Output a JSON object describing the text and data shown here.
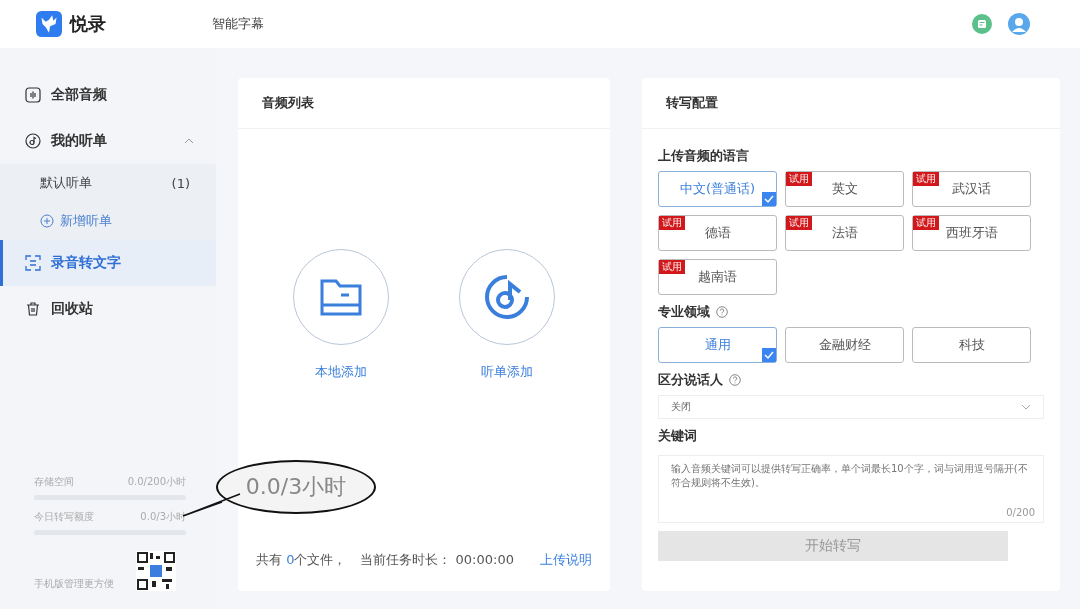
{
  "header": {
    "logo_text": "悦录",
    "nav_label": "智能字幕"
  },
  "sidebar": {
    "items": [
      {
        "kind": "audio",
        "label": "全部音频",
        "selected": false
      },
      {
        "kind": "group",
        "label": "我的听单",
        "expanded": true,
        "children": [
          {
            "label": "默认听单",
            "count": "(1)"
          }
        ],
        "add_label": "新增听单"
      },
      {
        "kind": "transcribe",
        "label": "录音转文字",
        "selected": true
      },
      {
        "kind": "trash",
        "label": "回收站",
        "selected": false
      }
    ],
    "usage": [
      {
        "label": "存储空间",
        "value": "0.0/200小时",
        "level": 0
      },
      {
        "label": "今日转写额度",
        "value": "0.0/3小时",
        "level": 0
      }
    ],
    "mobile_text": "手机版管理更方便"
  },
  "callout": {
    "text": "0.0/3小时"
  },
  "audio_list": {
    "title": "音频列表",
    "actions": [
      {
        "kind": "folder",
        "label": "本地添加"
      },
      {
        "kind": "disc",
        "label": "听单添加"
      }
    ],
    "footer": {
      "prefix": "共有",
      "count": "0",
      "suffix": "个文件，",
      "duration_label": "当前任务时长：",
      "duration": "00:00:00",
      "link": "上传说明"
    }
  },
  "config": {
    "title": "转写配置",
    "language": {
      "label": "上传音频的语言",
      "options": [
        {
          "label": "中文(普通话)",
          "selected": true
        },
        {
          "label": "英文",
          "badge": "试用",
          "selected": false
        },
        {
          "label": "武汉话",
          "badge": "试用",
          "selected": false
        },
        {
          "label": "德语",
          "badge": "试用",
          "selected": false
        },
        {
          "label": "法语",
          "badge": "试用",
          "selected": false
        },
        {
          "label": "西班牙语",
          "badge": "试用",
          "selected": false
        },
        {
          "label": "越南语",
          "badge": "试用",
          "selected": false
        }
      ]
    },
    "domain": {
      "label": "专业领域",
      "help": true,
      "options": [
        {
          "label": "通用",
          "selected": true
        },
        {
          "label": "金融财经",
          "selected": false
        },
        {
          "label": "科技",
          "selected": false
        }
      ]
    },
    "speaker": {
      "label": "区分说话人",
      "help": true,
      "value": "关闭"
    },
    "keywords": {
      "label": "关键词",
      "placeholder": "输入音频关键词可以提供转写正确率，单个词最长10个字，词与词用逗号隔开(不符合规则将不生效)。",
      "counter": "0/200"
    },
    "start_button": {
      "label": "开始转写",
      "disabled": true
    }
  }
}
